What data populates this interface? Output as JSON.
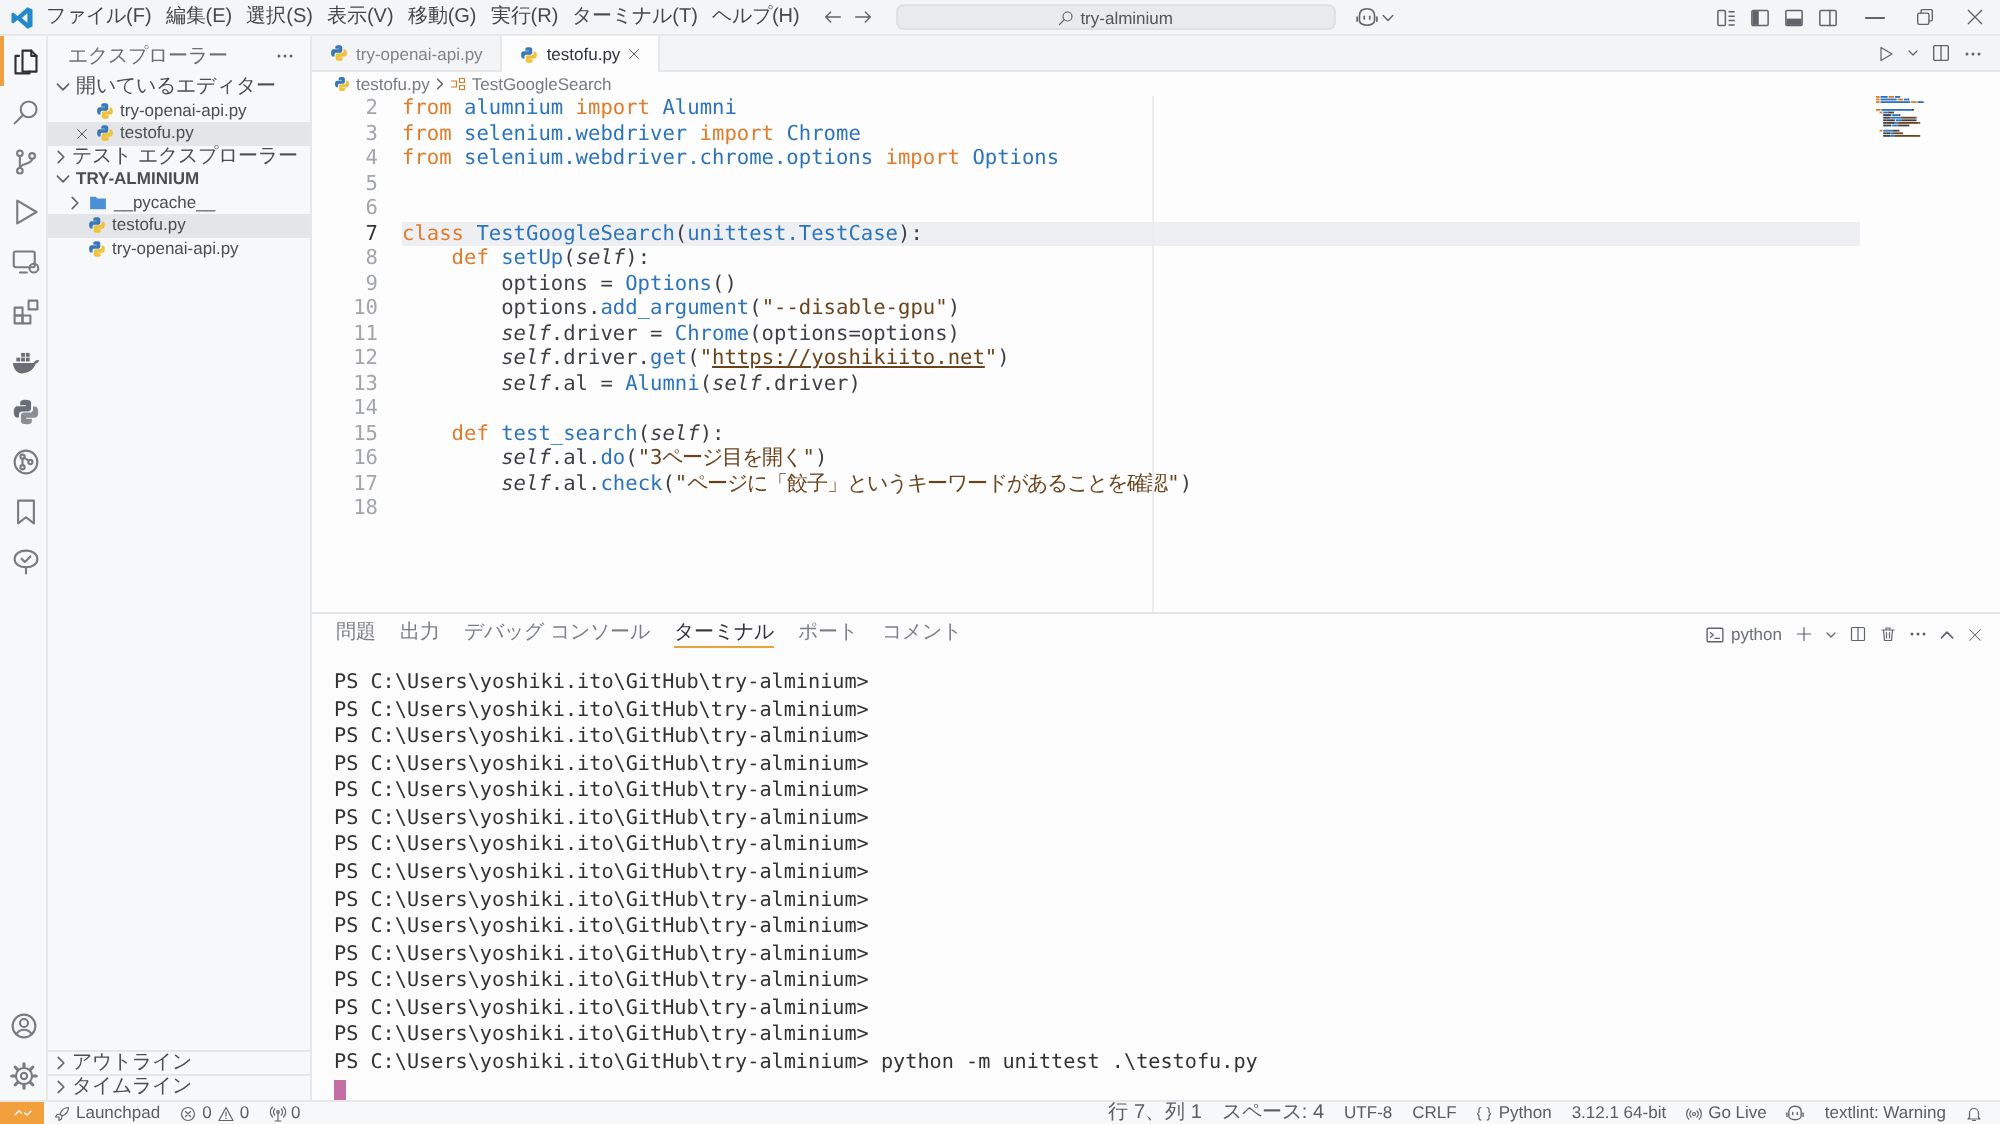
{
  "title_bar": {
    "menu": [
      "ファイル(F)",
      "編集(E)",
      "選択(S)",
      "表示(V)",
      "移動(G)",
      "実行(R)",
      "ターミナル(T)",
      "ヘルプ(H)"
    ],
    "search": "try-alminium"
  },
  "activity_bar": {
    "items": [
      {
        "kind": "files",
        "selected": true
      },
      {
        "kind": "search",
        "selected": false
      },
      {
        "kind": "source-control",
        "selected": false
      },
      {
        "kind": "run",
        "selected": false
      },
      {
        "kind": "remote",
        "selected": false
      },
      {
        "kind": "extensions",
        "selected": false
      },
      {
        "kind": "docker",
        "selected": false
      },
      {
        "kind": "python",
        "selected": false
      },
      {
        "kind": "gitlens",
        "selected": false
      },
      {
        "kind": "bookmarks",
        "selected": false
      },
      {
        "kind": "tree",
        "selected": false
      }
    ]
  },
  "sidebar": {
    "title": "エクスプローラー",
    "sections": [
      {
        "kind": "editors",
        "label": "開いているエディター",
        "expanded": true,
        "items": [
          {
            "name": "try-openai-api.py",
            "kind": "python",
            "selected": false
          },
          {
            "name": "testofu.py",
            "kind": "python",
            "selected": true
          }
        ]
      },
      {
        "kind": "tests",
        "label": "テスト エクスプローラー",
        "expanded": false
      },
      {
        "kind": "folder",
        "label": "TRY-ALMINIUM",
        "expanded": true,
        "items": [
          {
            "name": "__pycache__",
            "kind": "folder",
            "expanded": false,
            "selected": false
          },
          {
            "name": "testofu.py",
            "kind": "python",
            "selected": true
          },
          {
            "name": "try-openai-api.py",
            "kind": "python",
            "selected": false
          }
        ]
      }
    ],
    "footer_sections": [
      {
        "label": "アウトライン",
        "expanded": false
      },
      {
        "label": "タイムライン",
        "expanded": false
      }
    ]
  },
  "editor": {
    "tabs": [
      {
        "label": "try-openai-api.py",
        "selected": false
      },
      {
        "label": "testofu.py",
        "selected": true
      }
    ],
    "breadcrumb": [
      "testofu.py",
      "TestGoogleSearch"
    ],
    "lines": [
      {
        "number": "2",
        "current": false,
        "tokens": [
          {
            "text": "from ",
            "kind": "keyword"
          },
          {
            "text": "alumnium",
            "kind": "name"
          },
          {
            "text": " import ",
            "kind": "keyword"
          },
          {
            "text": "Alumni",
            "kind": "name"
          }
        ]
      },
      {
        "number": "3",
        "current": false,
        "tokens": [
          {
            "text": "from ",
            "kind": "keyword"
          },
          {
            "text": "selenium.webdriver",
            "kind": "name"
          },
          {
            "text": " import ",
            "kind": "keyword"
          },
          {
            "text": "Chrome",
            "kind": "name"
          }
        ]
      },
      {
        "number": "4",
        "current": false,
        "tokens": [
          {
            "text": "from ",
            "kind": "keyword"
          },
          {
            "text": "selenium.webdriver.chrome.options",
            "kind": "name"
          },
          {
            "text": " import ",
            "kind": "keyword"
          },
          {
            "text": "Options",
            "kind": "name"
          }
        ]
      },
      {
        "number": "5",
        "current": false
      },
      {
        "number": "6",
        "current": false
      },
      {
        "number": "7",
        "current": true,
        "tokens": [
          {
            "text": "class ",
            "kind": "keyword"
          },
          {
            "text": "TestGoogleSearch",
            "kind": "name"
          },
          {
            "text": "(",
            "kind": "plain"
          },
          {
            "text": "unittest.TestCase",
            "kind": "name"
          },
          {
            "text": "):",
            "kind": "plain"
          }
        ]
      },
      {
        "number": "8",
        "current": false,
        "tokens": [
          {
            "text": "    def ",
            "kind": "keyword"
          },
          {
            "text": "setUp",
            "kind": "name"
          },
          {
            "text": "(",
            "kind": "plain"
          },
          {
            "text": "self",
            "kind": "self"
          },
          {
            "text": "):",
            "kind": "plain"
          }
        ]
      },
      {
        "number": "9",
        "current": false,
        "tokens": [
          {
            "text": "        options = ",
            "kind": "plain"
          },
          {
            "text": "Options",
            "kind": "name"
          },
          {
            "text": "()",
            "kind": "plain"
          }
        ]
      },
      {
        "number": "10",
        "current": false,
        "tokens": [
          {
            "text": "        options.",
            "kind": "plain"
          },
          {
            "text": "add_argument",
            "kind": "name"
          },
          {
            "text": "(",
            "kind": "plain"
          },
          {
            "text": "\"--disable-gpu\"",
            "kind": "string"
          },
          {
            "text": ")",
            "kind": "plain"
          }
        ]
      },
      {
        "number": "11",
        "current": false,
        "tokens": [
          {
            "text": "        self",
            "kind": "self"
          },
          {
            "text": ".driver = ",
            "kind": "plain"
          },
          {
            "text": "Chrome",
            "kind": "name"
          },
          {
            "text": "(options=options)",
            "kind": "plain"
          }
        ]
      },
      {
        "number": "12",
        "current": false,
        "tokens": [
          {
            "text": "        self",
            "kind": "self"
          },
          {
            "text": ".driver.",
            "kind": "plain"
          },
          {
            "text": "get",
            "kind": "name"
          },
          {
            "text": "(",
            "kind": "plain"
          },
          {
            "text": "\"",
            "kind": "string"
          },
          {
            "text": "https://yoshikiito.net",
            "kind": "link"
          },
          {
            "text": "\"",
            "kind": "string"
          },
          {
            "text": ")",
            "kind": "plain"
          }
        ]
      },
      {
        "number": "13",
        "current": false,
        "tokens": [
          {
            "text": "        self",
            "kind": "self"
          },
          {
            "text": ".al = ",
            "kind": "plain"
          },
          {
            "text": "Alumni",
            "kind": "name"
          },
          {
            "text": "(",
            "kind": "plain"
          },
          {
            "text": "self",
            "kind": "self"
          },
          {
            "text": ".driver)",
            "kind": "plain"
          }
        ]
      },
      {
        "number": "14",
        "current": false
      },
      {
        "number": "15",
        "current": false,
        "tokens": [
          {
            "text": "    def ",
            "kind": "keyword"
          },
          {
            "text": "test_search",
            "kind": "name"
          },
          {
            "text": "(",
            "kind": "plain"
          },
          {
            "text": "self",
            "kind": "self"
          },
          {
            "text": "):",
            "kind": "plain"
          }
        ]
      },
      {
        "number": "16",
        "current": false,
        "tokens": [
          {
            "text": "        self",
            "kind": "self"
          },
          {
            "text": ".al.",
            "kind": "plain"
          },
          {
            "text": "do",
            "kind": "name"
          },
          {
            "text": "(",
            "kind": "plain"
          },
          {
            "text": "\"3ページ目を開く\"",
            "kind": "string"
          },
          {
            "text": ")",
            "kind": "plain"
          }
        ]
      },
      {
        "number": "17",
        "current": false,
        "tokens": [
          {
            "text": "        self",
            "kind": "self"
          },
          {
            "text": ".al.",
            "kind": "plain"
          },
          {
            "text": "check",
            "kind": "name"
          },
          {
            "text": "(",
            "kind": "plain"
          },
          {
            "text": "\"ページに「餃子」というキーワードがあることを確認\"",
            "kind": "string"
          },
          {
            "text": ")",
            "kind": "plain"
          }
        ]
      },
      {
        "number": "18",
        "current": false
      }
    ]
  },
  "panel": {
    "tabs": [
      {
        "label": "問題",
        "selected": false
      },
      {
        "label": "出力",
        "selected": false
      },
      {
        "label": "デバッグ コンソール",
        "selected": false
      },
      {
        "label": "ターミナル",
        "selected": true
      },
      {
        "label": "ポート",
        "selected": false
      },
      {
        "label": "コメント",
        "selected": false
      }
    ],
    "terminal_profile": "python",
    "terminal_lines": [
      "PS C:\\Users\\yoshiki.ito\\GitHub\\try-alminium>",
      "PS C:\\Users\\yoshiki.ito\\GitHub\\try-alminium>",
      "PS C:\\Users\\yoshiki.ito\\GitHub\\try-alminium>",
      "PS C:\\Users\\yoshiki.ito\\GitHub\\try-alminium>",
      "PS C:\\Users\\yoshiki.ito\\GitHub\\try-alminium>",
      "PS C:\\Users\\yoshiki.ito\\GitHub\\try-alminium>",
      "PS C:\\Users\\yoshiki.ito\\GitHub\\try-alminium>",
      "PS C:\\Users\\yoshiki.ito\\GitHub\\try-alminium>",
      "PS C:\\Users\\yoshiki.ito\\GitHub\\try-alminium>",
      "PS C:\\Users\\yoshiki.ito\\GitHub\\try-alminium>",
      "PS C:\\Users\\yoshiki.ito\\GitHub\\try-alminium>",
      "PS C:\\Users\\yoshiki.ito\\GitHub\\try-alminium>",
      "PS C:\\Users\\yoshiki.ito\\GitHub\\try-alminium>",
      "PS C:\\Users\\yoshiki.ito\\GitHub\\try-alminium>",
      "PS C:\\Users\\yoshiki.ito\\GitHub\\try-alminium> python -m unittest .\\testofu.py"
    ]
  },
  "status_bar": {
    "left": [
      {
        "kind": "remote"
      },
      {
        "kind": "launchpad",
        "text": "Launchpad"
      },
      {
        "kind": "problems",
        "errors": "0",
        "warnings": "0"
      },
      {
        "kind": "ports",
        "text": "0"
      }
    ],
    "right": [
      {
        "kind": "text",
        "text": "行 7、列 1"
      },
      {
        "kind": "text",
        "text": "スペース: 4"
      },
      {
        "kind": "text",
        "text": "UTF-8"
      },
      {
        "kind": "text",
        "text": "CRLF"
      },
      {
        "kind": "language",
        "text": "Python"
      },
      {
        "kind": "text",
        "text": "3.12.1 64-bit"
      },
      {
        "kind": "live",
        "text": "Go Live"
      },
      {
        "kind": "copilot"
      },
      {
        "kind": "text",
        "text": "textlint: Warning"
      },
      {
        "kind": "notifications"
      }
    ]
  }
}
